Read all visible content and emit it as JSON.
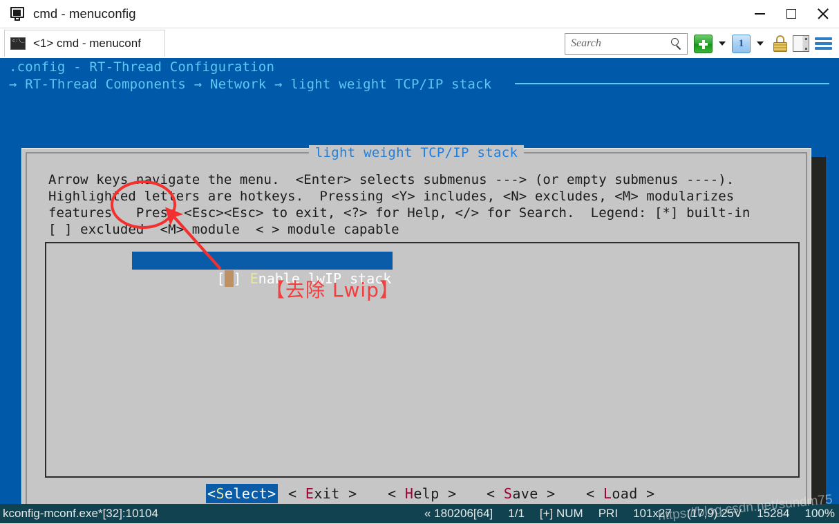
{
  "window": {
    "title": "cmd - menuconfig",
    "app_icon": "console-monitor-icon",
    "minimize_label": "Minimize",
    "maximize_label": "Maximize",
    "close_label": "Close"
  },
  "tab": {
    "label": "<1> cmd - menuconf",
    "icon": "console-icon",
    "icon_glyph": "c:\\_"
  },
  "toolbar": {
    "search_placeholder": "Search",
    "search_value": "",
    "new_tab_label": "+",
    "new_tab_dropdown": "▼",
    "tab_number": "1",
    "tab_dropdown": "▼",
    "lock_label": "Lock",
    "panel_label": "Panel",
    "menu_label": "Menu"
  },
  "console": {
    "config_title": ".config - RT-Thread Configuration",
    "breadcrumb": "→ RT-Thread Components → Network → light weight TCP/IP stack",
    "background_color": "#0059a9",
    "text_color": "#5fc8f5"
  },
  "dialog": {
    "title": "light weight TCP/IP stack",
    "help_text": "Arrow keys navigate the menu.  <Enter> selects submenus ---> (or empty submenus ----).\nHighlighted letters are hotkeys.  Pressing <Y> includes, <N> excludes, <M> modularizes\nfeatures.  Press <Esc><Esc> to exit, <?> for Help, </> for Search.  Legend: [*] built-in\n[ ] excluded  <M> module  < > module capable",
    "menu_items": [
      {
        "prefix_open": "[",
        "cursor": " ",
        "prefix_close": "] ",
        "hotkey": "E",
        "rest": "nable lwIP stack",
        "selected": true,
        "checked": false
      }
    ],
    "buttons": [
      {
        "left": "<",
        "key": "S",
        "rest": "elect",
        "right": ">",
        "selected": true
      },
      {
        "left": "< ",
        "key": "E",
        "rest": "xit",
        "right": " >",
        "selected": false
      },
      {
        "left": "< ",
        "key": "H",
        "rest": "elp",
        "right": " >",
        "selected": false
      },
      {
        "left": "< ",
        "key": "S",
        "rest": "ave",
        "right": " >",
        "selected": false
      },
      {
        "left": "< ",
        "key": "L",
        "rest": "oad",
        "right": " >",
        "selected": false
      }
    ]
  },
  "annotations": {
    "text": "【去除 Lwip】",
    "color": "#f43d3d",
    "ellipse_target": "checkbox-of-enable-lwip-stack",
    "arrow_target": "menu-item-enable-lwip-stack"
  },
  "statusbar": {
    "left": "kconfig-mconf.exe*[32]:10104",
    "items": [
      "« 180206[64]",
      "1/1",
      "[+] NUM",
      "PRI",
      "101x27",
      "(17,9) 25V",
      "15284",
      "100%"
    ]
  },
  "watermark": "https://blog.csdn.net/sundm75"
}
